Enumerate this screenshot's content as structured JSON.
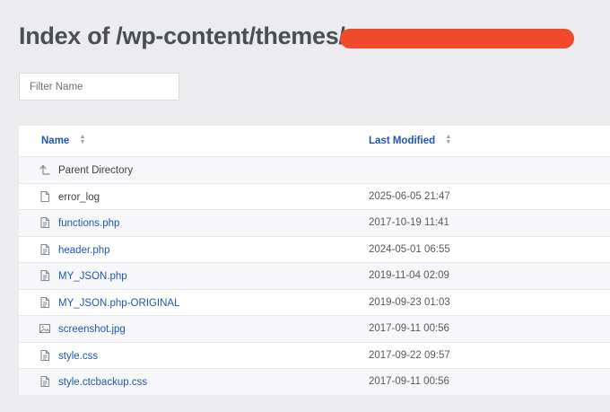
{
  "page": {
    "title": "Index of /wp-content/themes/",
    "filter_placeholder": "Filter Name"
  },
  "colors": {
    "background": "#ececee",
    "link": "#1f56b3",
    "redaction": "#f04a2a"
  },
  "table": {
    "columns": [
      "Name",
      "Last Modified"
    ],
    "parent_label": "Parent Directory",
    "rows": [
      {
        "name": "error_log",
        "modified": "2025-06-05 21:47",
        "icon": "file-icon"
      },
      {
        "name": "functions.php",
        "modified": "2017-10-19 11:41",
        "icon": "text-file-icon"
      },
      {
        "name": "header.php",
        "modified": "2024-05-01 06:55",
        "icon": "text-file-icon"
      },
      {
        "name": "MY_JSON.php",
        "modified": "2019-11-04 02:09",
        "icon": "text-file-icon"
      },
      {
        "name": "MY_JSON.php-ORIGINAL",
        "modified": "2019-09-23 01:03",
        "icon": "text-file-icon"
      },
      {
        "name": "screenshot.jpg",
        "modified": "2017-09-11 00:56",
        "icon": "image-file-icon"
      },
      {
        "name": "style.css",
        "modified": "2017-09-22 09:57",
        "icon": "text-file-icon"
      },
      {
        "name": "style.ctcbackup.css",
        "modified": "2017-09-11 00:56",
        "icon": "text-file-icon"
      }
    ]
  }
}
